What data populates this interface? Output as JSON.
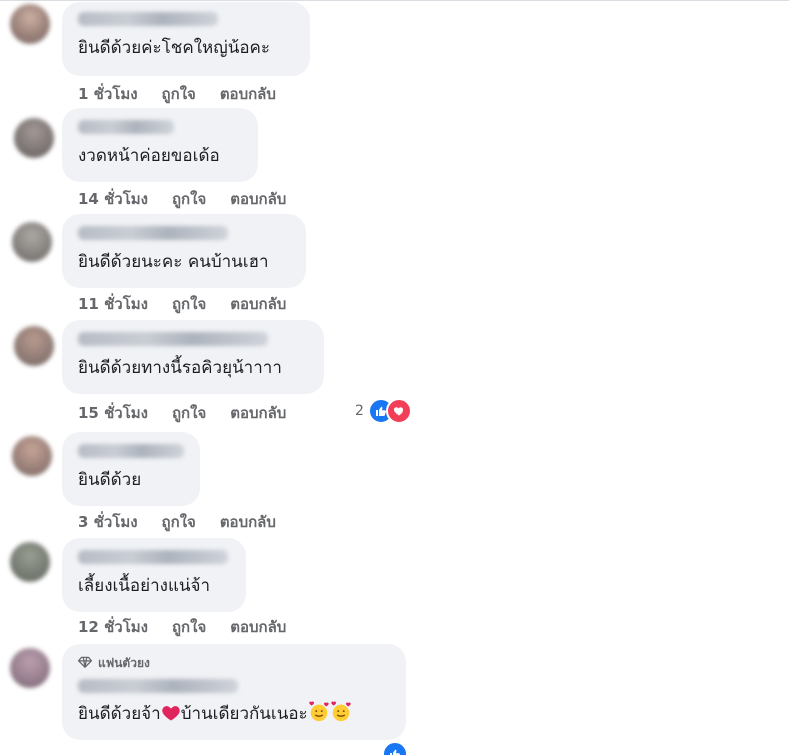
{
  "comments": [
    {
      "text": "ยินดีด้วยค่ะโชคใหญ่น้อคะ",
      "time": "1 ชั่วโมง",
      "like": "ถูกใจ",
      "reply": "ตอบกลับ"
    },
    {
      "text": "งวดหน้าค่อยขอเด้อ",
      "time": "14 ชั่วโมง",
      "like": "ถูกใจ",
      "reply": "ตอบกลับ"
    },
    {
      "text": "ยินดีด้วยนะคะ คนบ้านเฮา",
      "time": "11 ชั่วโมง",
      "like": "ถูกใจ",
      "reply": "ตอบกลับ"
    },
    {
      "text": "ยินดีด้วยทางนี้รอคิวยุน้าาาา",
      "time": "15 ชั่วโมง",
      "like": "ถูกใจ",
      "reply": "ตอบกลับ",
      "reaction_count": "2"
    },
    {
      "text": "ยินดีด้วย",
      "time": "3 ชั่วโมง",
      "like": "ถูกใจ",
      "reply": "ตอบกลับ"
    },
    {
      "text": "เลี้ยงเนื้อย่างแน่จ้า",
      "time": "12 ชั่วโมง",
      "like": "ถูกใจ",
      "reply": "ตอบกลับ"
    },
    {
      "badge": "แฟนตัวยง",
      "text_part1": "ยินดีด้วยจ้า",
      "text_part2": "บ้านเดียวกันเนอะ"
    }
  ],
  "icons": {
    "like_reaction": "like-icon",
    "love_reaction": "love-icon",
    "fan_badge": "diamond-icon",
    "heart_emoji": "red-heart-icon",
    "smiling_face_hearts": "smiling-face-hearts-icon"
  },
  "colors": {
    "bubble": "#f0f2f5",
    "text": "#1c1e21",
    "meta": "#65676b",
    "like_blue": "#1877f2",
    "love_red": "#f33e58"
  }
}
